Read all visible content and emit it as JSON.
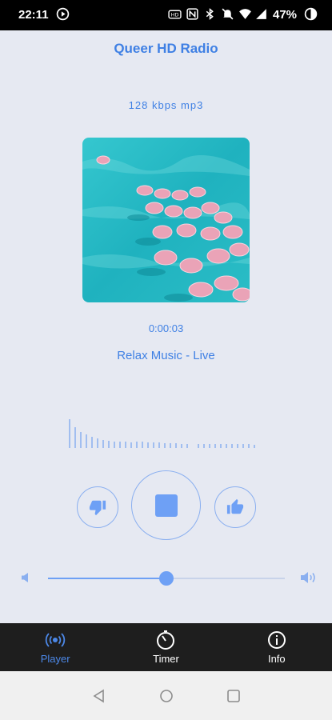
{
  "status": {
    "time": "22:11",
    "battery": "47%"
  },
  "app": {
    "title": "Queer HD Radio"
  },
  "player": {
    "bitrate": "128 kbps mp3",
    "elapsed": "0:00:03",
    "track": "Relax Music - Live",
    "volume_fraction": 0.5
  },
  "nav": {
    "items": [
      {
        "label": "Player"
      },
      {
        "label": "Timer"
      },
      {
        "label": "Info"
      }
    ]
  },
  "colors": {
    "accent": "#3f80e4",
    "button": "#6ea0f5",
    "background": "#e6e9f2",
    "nav_bg": "#1e1e1e"
  }
}
